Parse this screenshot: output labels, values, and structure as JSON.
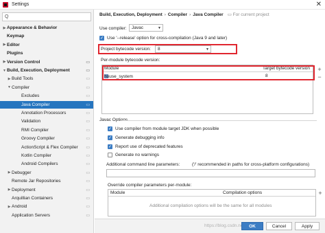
{
  "window": {
    "title": "Settings",
    "close": "✕"
  },
  "search": {
    "placeholder": "Q"
  },
  "sidebar": {
    "items": [
      {
        "label": "Appearance & Behavior",
        "arrow": "▶",
        "bold": true
      },
      {
        "label": "Keymap",
        "arrow": "",
        "bold": true
      },
      {
        "label": "Editor",
        "arrow": "▶",
        "bold": true
      },
      {
        "label": "Plugins",
        "arrow": "",
        "bold": true
      },
      {
        "label": "Version Control",
        "arrow": "▶",
        "bold": true
      },
      {
        "label": "Build, Execution, Deployment",
        "arrow": "▼",
        "bold": true
      },
      {
        "label": "Build Tools",
        "arrow": "▶",
        "bold": false
      },
      {
        "label": "Compiler",
        "arrow": "▼",
        "bold": false
      },
      {
        "label": "Excludes",
        "arrow": "",
        "bold": false
      },
      {
        "label": "Java Compiler",
        "arrow": "",
        "bold": false,
        "selected": true
      },
      {
        "label": "Annotation Processors",
        "arrow": "",
        "bold": false
      },
      {
        "label": "Validation",
        "arrow": "",
        "bold": false
      },
      {
        "label": "RMI Compiler",
        "arrow": "",
        "bold": false
      },
      {
        "label": "Groovy Compiler",
        "arrow": "",
        "bold": false
      },
      {
        "label": "ActionScript & Flex Compiler",
        "arrow": "",
        "bold": false
      },
      {
        "label": "Kotlin Compiler",
        "arrow": "",
        "bold": false
      },
      {
        "label": "Android Compilers",
        "arrow": "",
        "bold": false
      },
      {
        "label": "Debugger",
        "arrow": "▶",
        "bold": false
      },
      {
        "label": "Remote Jar Repositories",
        "arrow": "",
        "bold": false
      },
      {
        "label": "Deployment",
        "arrow": "▶",
        "bold": false
      },
      {
        "label": "Arquillian Containers",
        "arrow": "",
        "bold": false
      },
      {
        "label": "Android",
        "arrow": "▶",
        "bold": false
      },
      {
        "label": "Application Servers",
        "arrow": "",
        "bold": false
      }
    ]
  },
  "breadcrumb": {
    "part1": "Build, Execution, Deployment",
    "part2": "Compiler",
    "part3": "Java Compiler",
    "separator": "›",
    "project_note": "For current project"
  },
  "compiler": {
    "use_compiler_label": "Use compiler:",
    "use_compiler_value": "Javac",
    "release_option_label": "Use '--release' option for cross-compilation (Java 9 and later)",
    "release_option_checked": true,
    "project_bytecode_label": "Project bytecode version:",
    "project_bytecode_value": "8",
    "per_module_label": "Per-module bytecode version:"
  },
  "module_table": {
    "col_module": "Module",
    "col_target": "Target bytecode version",
    "rows": [
      {
        "module": "house_system",
        "target": "8"
      }
    ],
    "add": "+",
    "remove": "−"
  },
  "javac_options": {
    "section_label": "Javac Options",
    "use_module_jdk_label": "Use compiler from module target JDK when possible",
    "use_module_jdk_checked": true,
    "generate_debug_label": "Generate debugging info",
    "generate_debug_checked": true,
    "report_deprecated_label": "Report use of deprecated features",
    "report_deprecated_checked": true,
    "generate_no_warnings_label": "Generate no warnings",
    "generate_no_warnings_checked": false,
    "additional_params_label": "Additional command line parameters:",
    "additional_params_hint": "('/' recommended in paths for cross-platform configurations)",
    "additional_params_value": "",
    "override_label": "Override compiler parameters per-module:"
  },
  "override_table": {
    "col_module": "Module",
    "col_options": "Compilation options",
    "empty_text": "Additional compilation options will be the same for all modules",
    "add": "+"
  },
  "buttons": {
    "ok": "OK",
    "cancel": "Cancel",
    "apply": "Apply"
  },
  "watermark": "https://blog.csdn.net/...",
  "colors": {
    "accent": "#2675bf",
    "highlight": "#e0262f"
  }
}
